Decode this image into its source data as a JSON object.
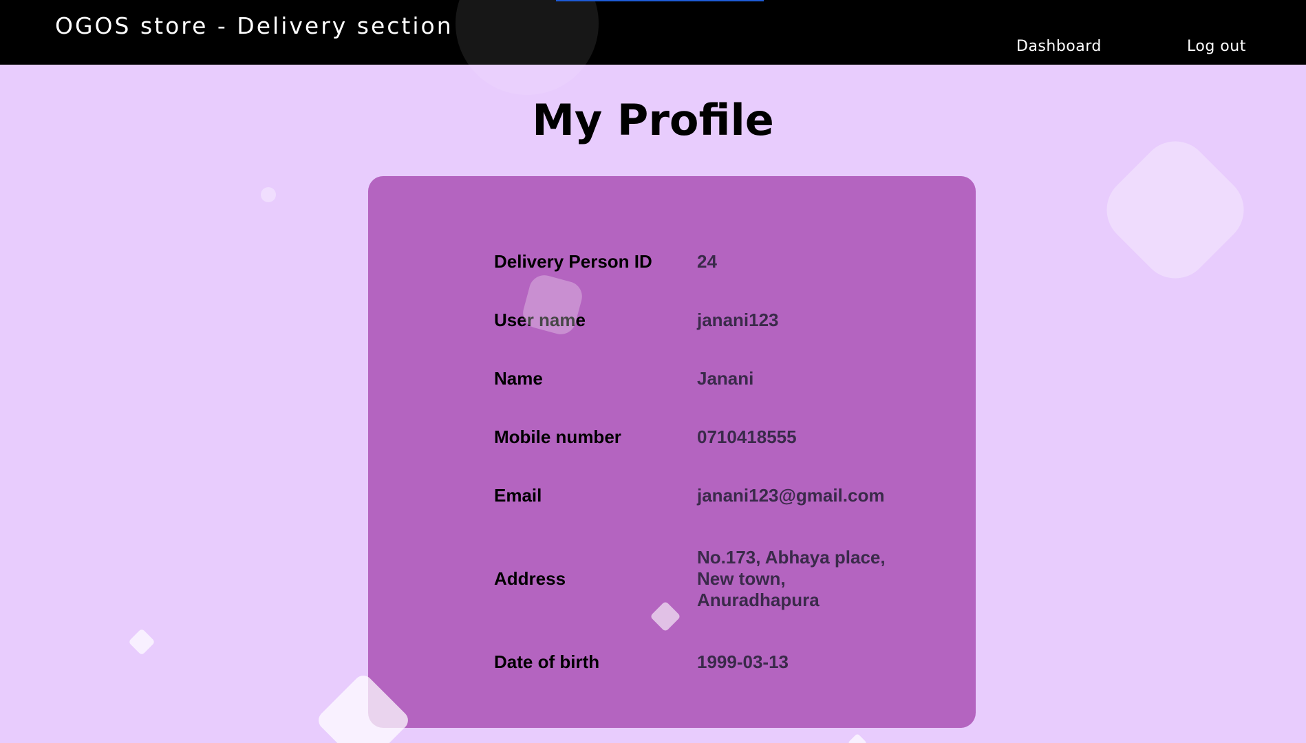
{
  "header": {
    "brand": "OGOS store - Delivery section",
    "nav": {
      "dashboard": "Dashboard",
      "logout": "Log out"
    }
  },
  "page": {
    "title": "My Profile"
  },
  "profile": {
    "rows": [
      {
        "label": "Delivery Person ID",
        "value": "24"
      },
      {
        "label": "User name",
        "value": "janani123"
      },
      {
        "label": "Name",
        "value": "Janani"
      },
      {
        "label": "Mobile number",
        "value": "0710418555"
      },
      {
        "label": "Email",
        "value": "janani123@gmail.com"
      },
      {
        "label": "Address",
        "value_lines": [
          "No.173, Abhaya place,",
          "New town,",
          "Anuradhapura"
        ]
      },
      {
        "label": "Date of birth",
        "value": "1999-03-13"
      }
    ]
  },
  "colors": {
    "background": "#e8ccfd",
    "header": "#000000",
    "card": "#b464c0",
    "accent_bar": "#1d5bd6"
  }
}
